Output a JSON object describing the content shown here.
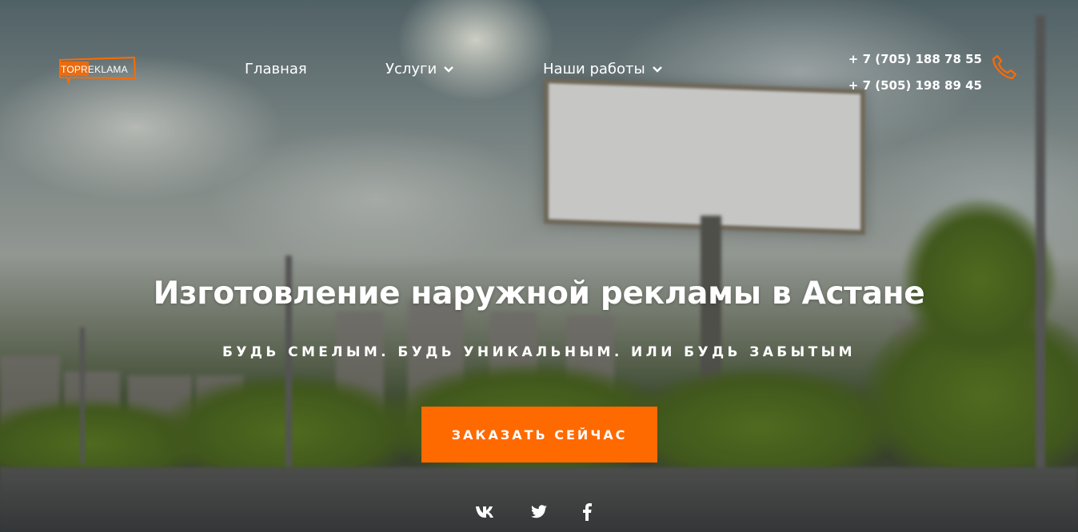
{
  "header": {
    "logo_text": "TOPREKLAMA",
    "nav": [
      {
        "label": "Главная"
      },
      {
        "label": "Услуги"
      },
      {
        "label": "Наши работы"
      }
    ],
    "phones": [
      "+ 7 (705) 188 78 55",
      "+ 7 (505) 198 89 45"
    ]
  },
  "hero": {
    "title": "Изготовление наружной рекламы в Астане",
    "subtitle": "БУДЬ СМЕЛЫМ. БУДЬ УНИКАЛЬНЫМ. ИЛИ БУДЬ ЗАБЫТЫМ",
    "cta_label": "ЗАКАЗАТЬ СЕЙЧАС"
  },
  "social": [
    {
      "icon": "vk-icon"
    },
    {
      "icon": "twitter-icon"
    },
    {
      "icon": "facebook-icon"
    }
  ],
  "colors": {
    "accent": "#ff6a00",
    "text": "#ffffff"
  }
}
